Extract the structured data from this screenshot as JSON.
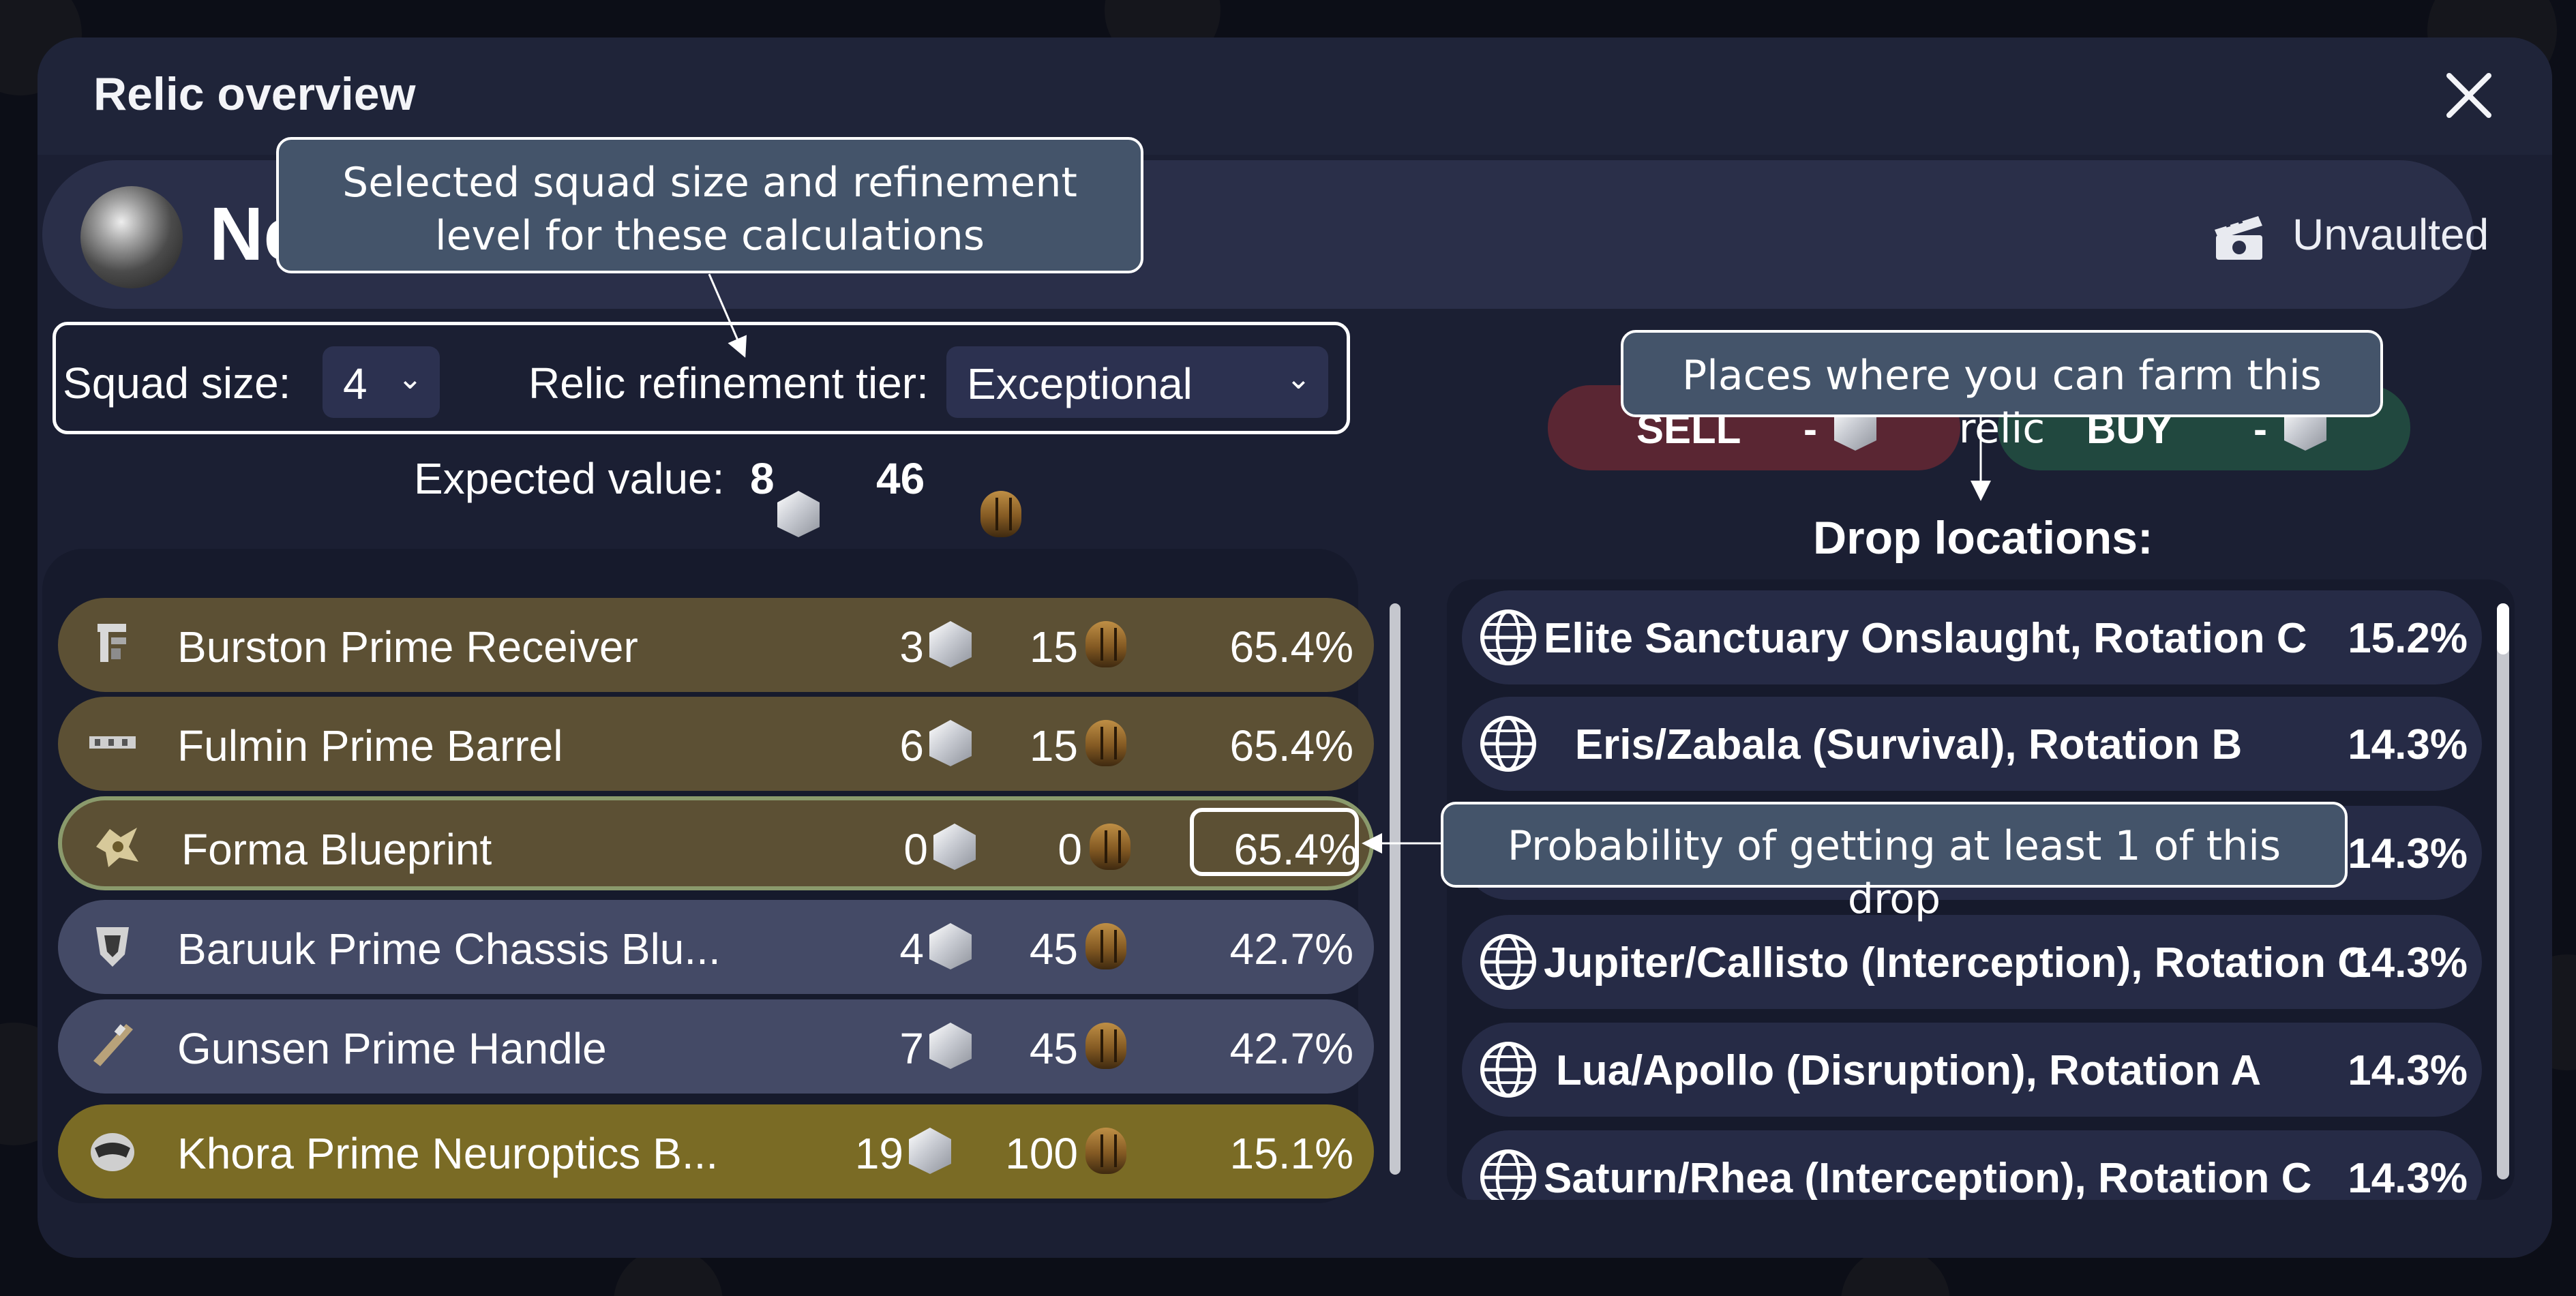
{
  "modal": {
    "title": "Relic overview"
  },
  "relic": {
    "name": "Neo K7",
    "status": "Unvaulted"
  },
  "controls": {
    "squad_label": "Squad size:",
    "squad_value": "4",
    "tier_label": "Relic refinement tier:",
    "tier_value": "Exceptional"
  },
  "expected_value": {
    "label": "Expected value:",
    "platinum": "8",
    "ducats": "46"
  },
  "rewards": [
    {
      "name": "Burston Prime Receiver",
      "platinum": "3",
      "ducats": "15",
      "chance": "65.4%",
      "rarity": "common",
      "icon": "receiver-icon"
    },
    {
      "name": "Fulmin Prime Barrel",
      "platinum": "6",
      "ducats": "15",
      "chance": "65.4%",
      "rarity": "common",
      "icon": "barrel-icon"
    },
    {
      "name": "Forma Blueprint",
      "platinum": "0",
      "ducats": "0",
      "chance": "65.4%",
      "rarity": "common",
      "icon": "forma-icon"
    },
    {
      "name": "Baruuk Prime Chassis Blu...",
      "platinum": "4",
      "ducats": "45",
      "chance": "42.7%",
      "rarity": "uncommon",
      "icon": "chassis-icon"
    },
    {
      "name": "Gunsen Prime Handle",
      "platinum": "7",
      "ducats": "45",
      "chance": "42.7%",
      "rarity": "uncommon",
      "icon": "handle-icon"
    },
    {
      "name": "Khora Prime Neuroptics B...",
      "platinum": "19",
      "ducats": "100",
      "chance": "15.1%",
      "rarity": "rare",
      "icon": "neuroptics-icon"
    }
  ],
  "market": {
    "sell_label": "SELL",
    "sell_price": "-",
    "buy_label": "BUY",
    "buy_price": "-"
  },
  "drop_locations": {
    "title": "Drop locations:",
    "items": [
      {
        "name": "Elite Sanctuary Onslaught, Rotation C",
        "chance": "15.2%"
      },
      {
        "name": "Eris/Zabala (Survival), Rotation B",
        "chance": "14.3%"
      },
      {
        "name": "",
        "chance": "14.3%"
      },
      {
        "name": "Jupiter/Callisto (Interception), Rotation C",
        "chance": "14.3%"
      },
      {
        "name": "Lua/Apollo (Disruption), Rotation A",
        "chance": "14.3%"
      },
      {
        "name": "Saturn/Rhea (Interception), Rotation C",
        "chance": "14.3%"
      }
    ]
  },
  "annotations": {
    "selection": "Selected squad size and refinement level for these calculations",
    "farm": "Places where you can farm this relic",
    "probability": "Probability of getting at least 1 of this drop"
  },
  "colors": {
    "modal_bg": "#1b1f33",
    "common_row": "#5c5034",
    "uncommon_row": "#444a66",
    "rare_row": "#7a6b25",
    "sell": "#5a2633",
    "buy": "#21483f",
    "callout_bg": "#44546a"
  }
}
